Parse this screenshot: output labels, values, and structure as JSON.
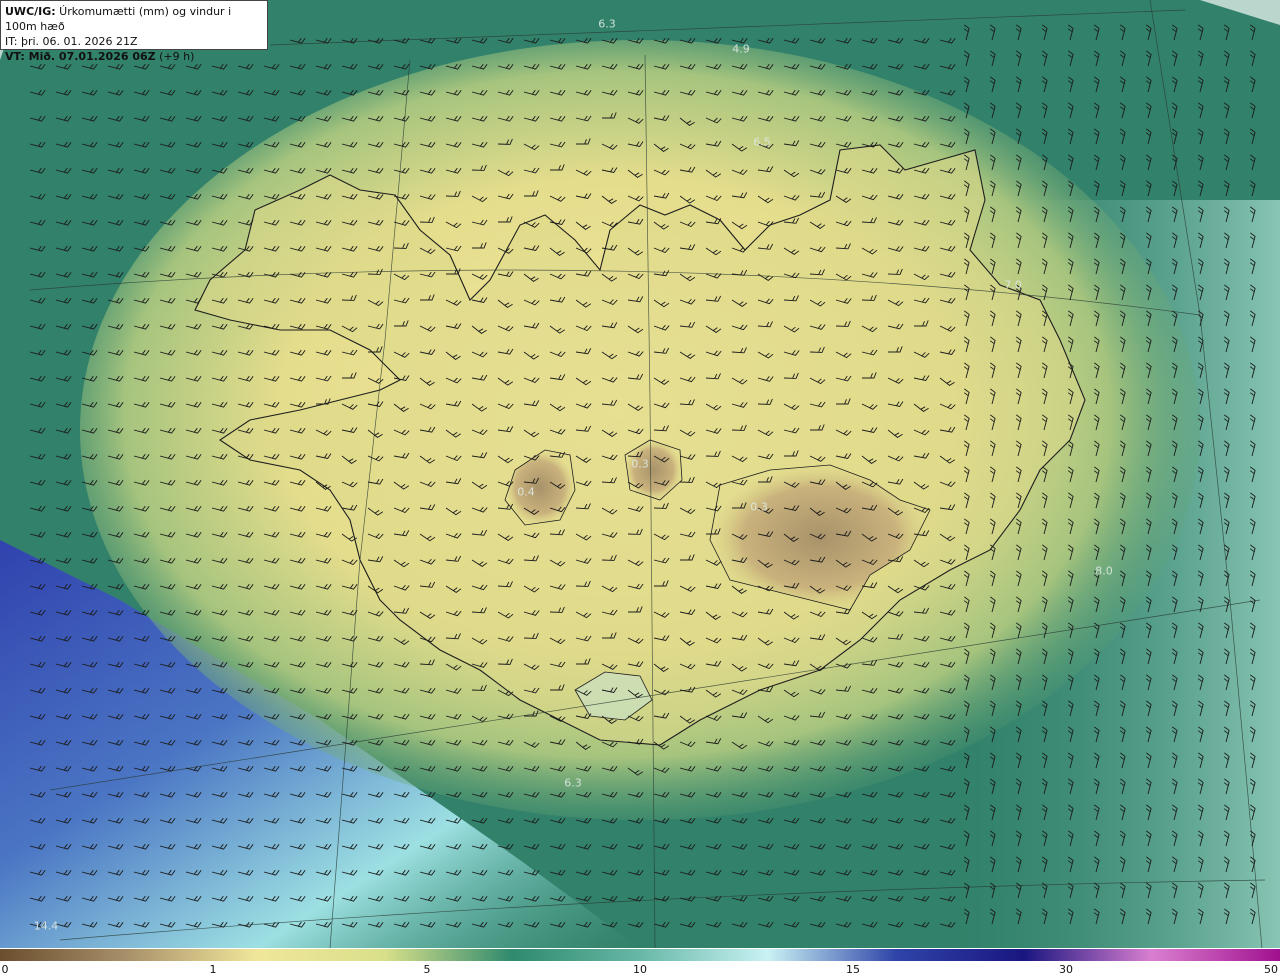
{
  "header": {
    "line1_bold": "UWC/IG:",
    "line1_rest": " Úrkomumætti (mm) og vindur i 100m hæð",
    "line2": "IT: þri. 06. 01. 2026 21Z",
    "line3_bold": "VT: Mið. 07.01.2026 06Z",
    "line3_rest": " (+9 h)"
  },
  "value_labels": [
    "6.3",
    "4.9",
    "6.5",
    "7.0",
    "0.3",
    "0.4",
    "0.3",
    "8.0",
    "6.3",
    "14.4"
  ],
  "legend": {
    "ticks": [
      "0",
      "1",
      "5",
      "10",
      "15",
      "30",
      "50"
    ],
    "colors": [
      "#6b4e2e",
      "#a8916a",
      "#f0e69a",
      "#d9e08a",
      "#2f8a6e",
      "#67b8a6",
      "#c9f2f4",
      "#2f44a8",
      "#1a1680",
      "#d97fd0",
      "#a0108e"
    ]
  },
  "field_colors": {
    "ocean": "#2f7d68",
    "land_low": "#cfd98a",
    "land_dry": "#efe596",
    "glacier_dry": "#b3a275",
    "southwest_band": "#84cfc6",
    "southwest_deep": "#3345b0",
    "east_wet": "#7fc6b2"
  }
}
